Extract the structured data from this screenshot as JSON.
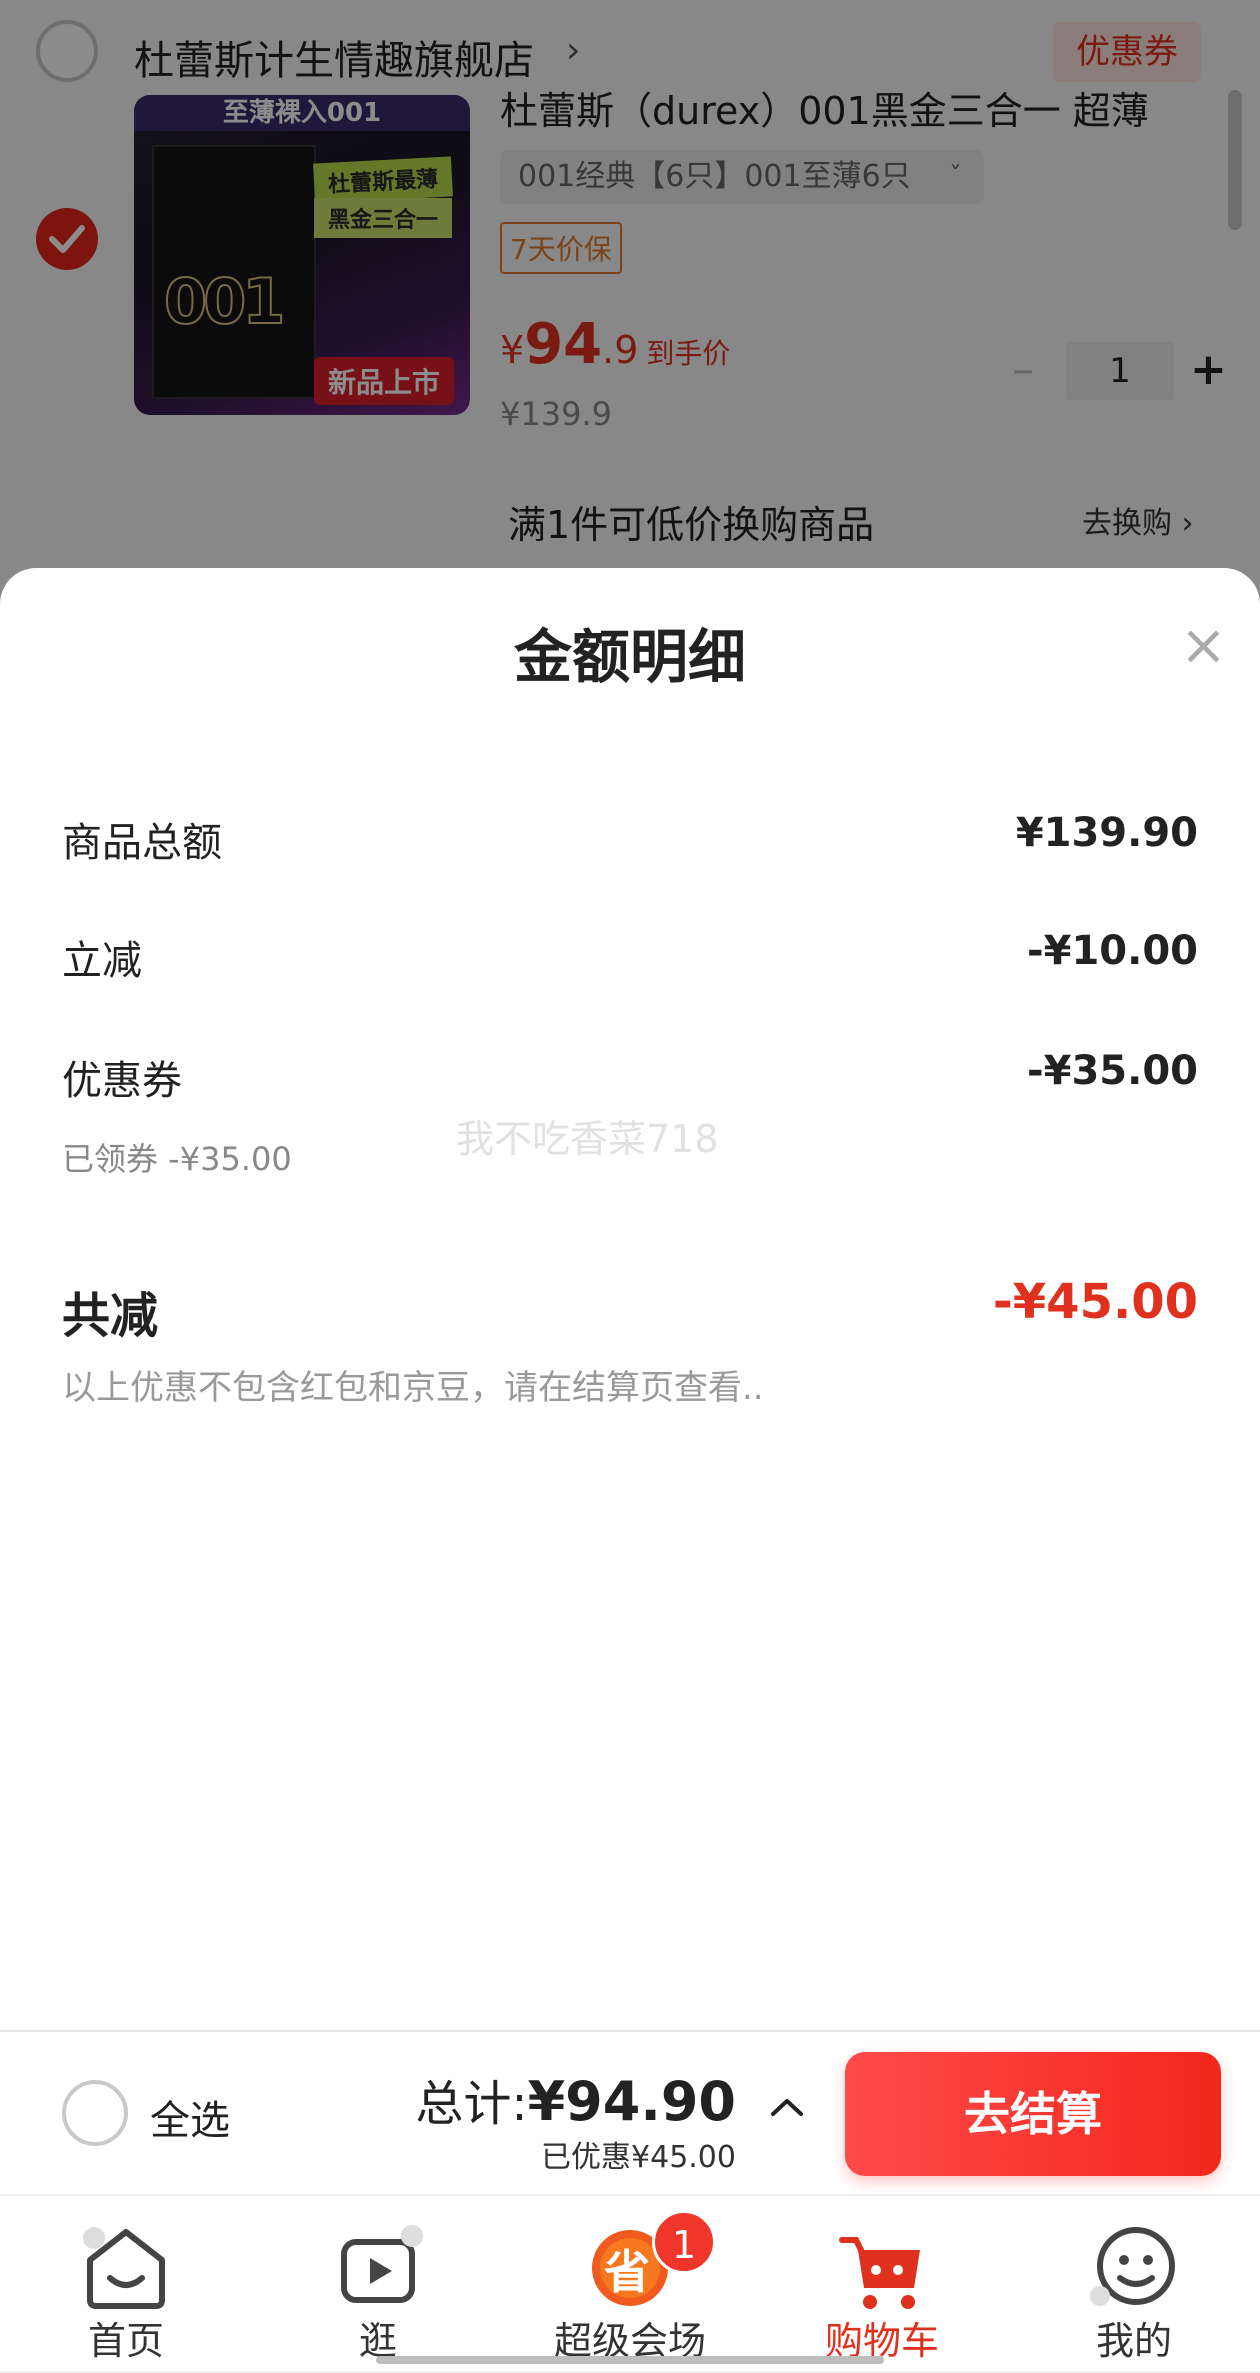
{
  "cart": {
    "store_name": "杜蕾斯计生情趣旗舰店",
    "store_chevron": "›",
    "coupon_tag": "优惠券",
    "product": {
      "title": "杜蕾斯（durex）001黑金三合一 超薄",
      "spec": "001经典【6只】001至薄6只",
      "spec_arrow": "ˇ",
      "price_protect": "7天价保",
      "price_symbol": "¥",
      "price_int": "94",
      "price_dec": ".9",
      "price_suffix": "到手价",
      "original_price": "¥139.9",
      "quantity": "1",
      "image_texts": {
        "band": "至薄裸入001",
        "label1": "杜蕾斯最薄",
        "label2": "黑金三合一",
        "zeros": "001",
        "new": "新品上市"
      }
    },
    "swap_text": "满1件可低价换购商品",
    "swap_link": "去换购 ›"
  },
  "sheet": {
    "title": "金额明细",
    "close_glyph": "×",
    "rows": [
      {
        "label": "商品总额",
        "value": "¥139.90"
      },
      {
        "label": "立减",
        "value": "-¥10.00"
      },
      {
        "label": "优惠券",
        "value": "-¥35.00",
        "sub": "已领券 -¥35.00"
      }
    ],
    "watermark": "我不吃香菜718",
    "total_label": "共减",
    "total_value": "-¥45.00",
    "note": "以上优惠不包含红包和京豆，请在结算页查看.."
  },
  "checkout": {
    "select_all": "全选",
    "total_prefix": "总计:",
    "total_value": "¥94.90",
    "saved": "已优惠¥45.00",
    "pay_button": "去结算"
  },
  "tabbar": {
    "items": [
      {
        "label": "首页",
        "icon": "home-icon"
      },
      {
        "label": "逛",
        "icon": "video-icon"
      },
      {
        "label": "超级会场",
        "icon": "super-venue-icon",
        "badge": "1",
        "icon_text": "省"
      },
      {
        "label": "购物车",
        "icon": "cart-icon",
        "active": true
      },
      {
        "label": "我的",
        "icon": "profile-icon"
      }
    ]
  },
  "colors": {
    "accent": "#e0301e",
    "price_protect": "#e07a2a"
  }
}
